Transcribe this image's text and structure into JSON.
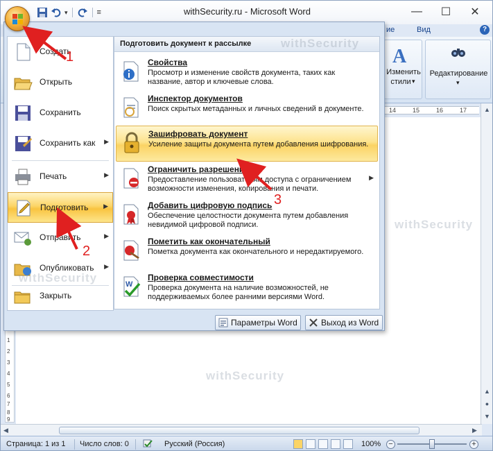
{
  "window": {
    "title": "withSecurity.ru - Microsoft Word",
    "controls": {
      "minimize": "—",
      "maximize": "☐",
      "close": "✕"
    }
  },
  "quick_access": {
    "icons": [
      "save-icon",
      "undo-icon",
      "redo-icon",
      "customize-icon"
    ],
    "undo_dropdown": "▾",
    "customize_glyph": "≡"
  },
  "ribbon": {
    "tabs": {
      "partial": "ие",
      "view": "Вид"
    },
    "help": "?",
    "styles_label": "Изменить",
    "styles_label2": "стили",
    "editing_label": "Редактирование",
    "dropdown": "▾"
  },
  "ruler": {
    "ticks": [
      "14",
      "15",
      "16",
      "17"
    ],
    "vertical": [
      "1",
      "2",
      "3",
      "4",
      "5",
      "6",
      "7",
      "8",
      "9"
    ]
  },
  "office_menu": {
    "items": [
      {
        "label": "Создать",
        "icon": "new-document-icon",
        "has_arrow": false
      },
      {
        "label": "Открыть",
        "icon": "open-folder-icon",
        "has_arrow": false
      },
      {
        "label": "Сохранить",
        "icon": "save-icon",
        "has_arrow": false
      },
      {
        "label": "Сохранить как",
        "icon": "save-as-icon",
        "has_arrow": true
      },
      {
        "label": "Печать",
        "icon": "print-icon",
        "has_arrow": true
      },
      {
        "label": "Подготовить",
        "icon": "prepare-icon",
        "has_arrow": true,
        "active": true
      },
      {
        "label": "Отправить",
        "icon": "send-icon",
        "has_arrow": true
      },
      {
        "label": "Опубликовать",
        "icon": "publish-icon",
        "has_arrow": true
      },
      {
        "label": "Закрыть",
        "icon": "close-folder-icon",
        "has_arrow": false
      }
    ],
    "arrow": "▶",
    "submenu": {
      "header": "Подготовить документ к рассылке",
      "items": [
        {
          "title": "Свойства",
          "desc": "Просмотр и изменение свойств документа, таких как название, автор и ключевые слова.",
          "icon": "properties-icon"
        },
        {
          "title": "Инспектор документов",
          "desc": "Поиск скрытых метаданных и личных сведений в документе.",
          "icon": "inspect-document-icon"
        },
        {
          "title": "Зашифровать документ",
          "desc": "Усиление защиты документа путем добавления шифрования.",
          "icon": "encrypt-lock-icon",
          "active": true
        },
        {
          "title": "Ограничить разрешения",
          "desc": "Предоставление пользователям доступа с ограничением возможности изменения, копирования и печати.",
          "icon": "restrict-permission-icon",
          "has_arrow": true
        },
        {
          "title": "Добавить цифровую подпись",
          "desc": "Обеспечение целостности документа путем добавления невидимой цифровой подписи.",
          "icon": "digital-signature-icon"
        },
        {
          "title": "Пометить как окончательный",
          "desc": "Пометка документа как окончательного и нередактируемого.",
          "icon": "mark-final-icon"
        },
        {
          "title": "Проверка совместимости",
          "desc": "Проверка документа на наличие возможностей, не поддерживаемых более ранними версиями Word.",
          "icon": "compatibility-check-icon"
        }
      ]
    },
    "buttons": {
      "options": "Параметры Word",
      "exit": "Выход из Word"
    }
  },
  "statusbar": {
    "page": "Страница: 1 из 1",
    "words": "Число слов: 0",
    "language": "Русский (Россия)",
    "zoom": "100%",
    "zoom_minus": "−",
    "zoom_plus": "+"
  },
  "watermark": "withSecurity",
  "annotations": [
    "1",
    "2",
    "3"
  ],
  "colors": {
    "accent": "#e02020",
    "highlight": "#fcd567",
    "ribbon_text": "#15428b"
  }
}
